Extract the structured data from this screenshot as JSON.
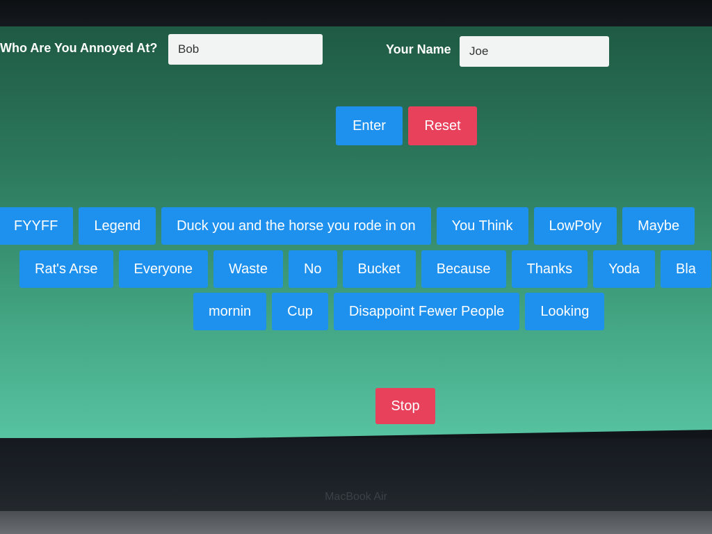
{
  "form": {
    "target_label": "Who Are You Annoyed At?",
    "target_value": "Bob",
    "name_label": "Your Name",
    "name_value": "Joe"
  },
  "actions": {
    "enter_label": "Enter",
    "reset_label": "Reset",
    "stop_label": "Stop"
  },
  "word_rows": [
    [
      "FYYFF",
      "Legend",
      "Duck you and the horse you rode in on",
      "You Think",
      "LowPoly",
      "Maybe"
    ],
    [
      "Rat's Arse",
      "Everyone",
      "Waste",
      "No",
      "Bucket",
      "Because",
      "Thanks",
      "Yoda",
      "Bla"
    ],
    [
      "mornin",
      "Cup",
      "Disappoint Fewer People",
      "Looking"
    ]
  ],
  "hardware": {
    "device_label": "MacBook Air"
  }
}
